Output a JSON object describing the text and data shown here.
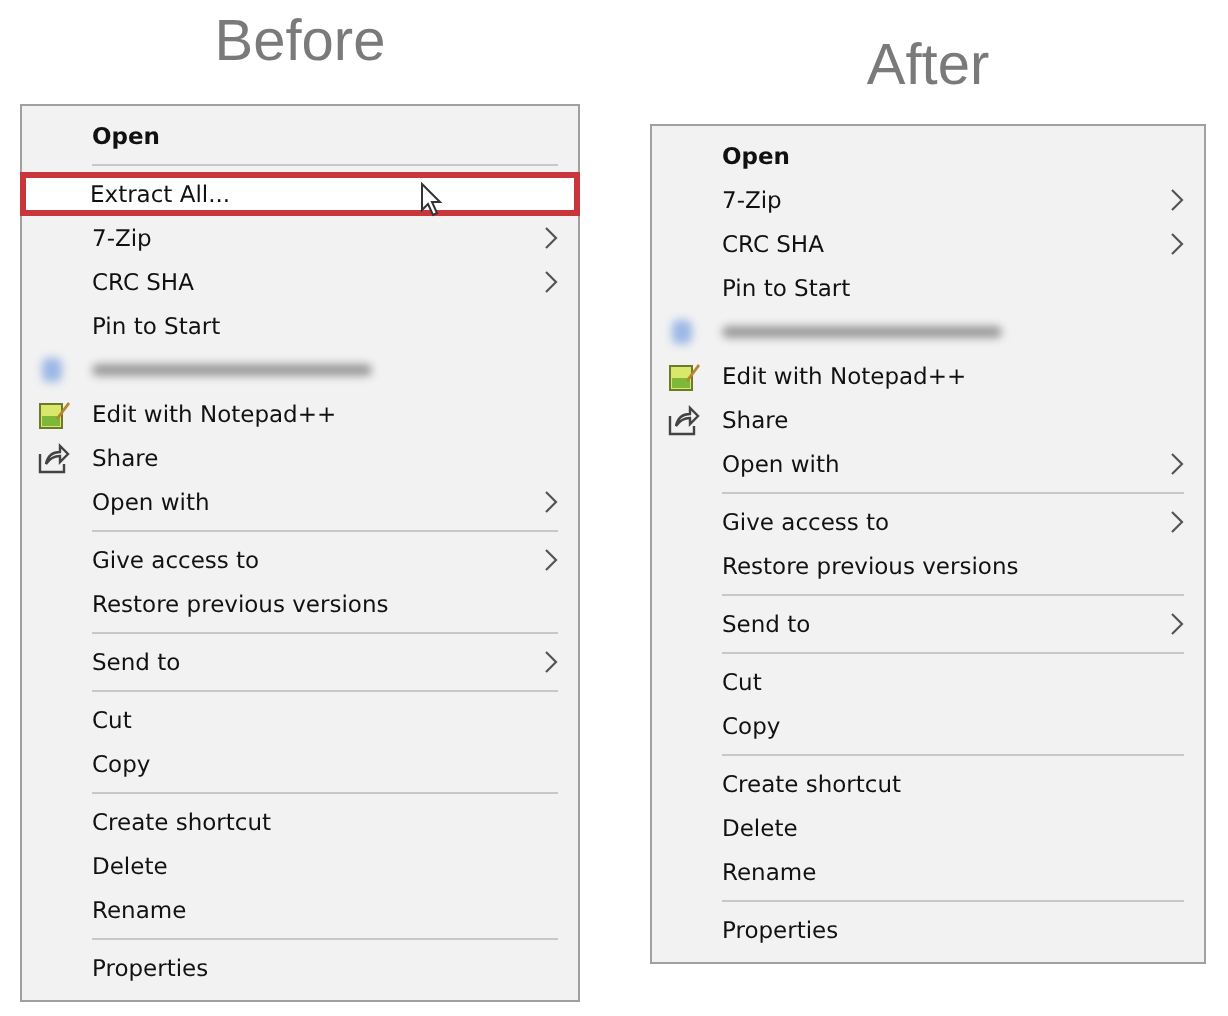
{
  "panels": [
    {
      "heading": "Before",
      "items": [
        {
          "kind": "item",
          "label": "Open",
          "bold": true,
          "submenu": false,
          "selected": false
        },
        {
          "kind": "separator"
        },
        {
          "kind": "item",
          "label": "Extract All...",
          "bold": false,
          "submenu": false,
          "selected": true
        },
        {
          "kind": "item",
          "label": "7-Zip",
          "bold": false,
          "submenu": true,
          "selected": false
        },
        {
          "kind": "item",
          "label": "CRC SHA",
          "bold": false,
          "submenu": true,
          "selected": false
        },
        {
          "kind": "item",
          "label": "Pin to Start",
          "bold": false,
          "submenu": false,
          "selected": false
        },
        {
          "kind": "blurred"
        },
        {
          "kind": "edit-item",
          "label": "Edit with Notepad++",
          "bold": false,
          "submenu": false,
          "selected": false
        },
        {
          "kind": "share-item",
          "label": "Share",
          "bold": false,
          "submenu": false,
          "selected": false
        },
        {
          "kind": "item",
          "label": "Open with",
          "bold": false,
          "submenu": true,
          "selected": false
        },
        {
          "kind": "separator"
        },
        {
          "kind": "item",
          "label": "Give access to",
          "bold": false,
          "submenu": true,
          "selected": false
        },
        {
          "kind": "item",
          "label": "Restore previous versions",
          "bold": false,
          "submenu": false,
          "selected": false
        },
        {
          "kind": "separator"
        },
        {
          "kind": "item",
          "label": "Send to",
          "bold": false,
          "submenu": true,
          "selected": false
        },
        {
          "kind": "separator"
        },
        {
          "kind": "item",
          "label": "Cut",
          "bold": false,
          "submenu": false,
          "selected": false
        },
        {
          "kind": "item",
          "label": "Copy",
          "bold": false,
          "submenu": false,
          "selected": false
        },
        {
          "kind": "separator"
        },
        {
          "kind": "item",
          "label": "Create shortcut",
          "bold": false,
          "submenu": false,
          "selected": false
        },
        {
          "kind": "item",
          "label": "Delete",
          "bold": false,
          "submenu": false,
          "selected": false
        },
        {
          "kind": "item",
          "label": "Rename",
          "bold": false,
          "submenu": false,
          "selected": false
        },
        {
          "kind": "separator"
        },
        {
          "kind": "item",
          "label": "Properties",
          "bold": false,
          "submenu": false,
          "selected": false
        }
      ]
    },
    {
      "heading": "After",
      "items": [
        {
          "kind": "item",
          "label": "Open",
          "bold": true,
          "submenu": false,
          "selected": false
        },
        {
          "kind": "item",
          "label": "7-Zip",
          "bold": false,
          "submenu": true,
          "selected": false
        },
        {
          "kind": "item",
          "label": "CRC SHA",
          "bold": false,
          "submenu": true,
          "selected": false
        },
        {
          "kind": "item",
          "label": "Pin to Start",
          "bold": false,
          "submenu": false,
          "selected": false
        },
        {
          "kind": "blurred"
        },
        {
          "kind": "edit-item",
          "label": "Edit with Notepad++",
          "bold": false,
          "submenu": false,
          "selected": false
        },
        {
          "kind": "share-item",
          "label": "Share",
          "bold": false,
          "submenu": false,
          "selected": false
        },
        {
          "kind": "item",
          "label": "Open with",
          "bold": false,
          "submenu": true,
          "selected": false
        },
        {
          "kind": "separator"
        },
        {
          "kind": "item",
          "label": "Give access to",
          "bold": false,
          "submenu": true,
          "selected": false
        },
        {
          "kind": "item",
          "label": "Restore previous versions",
          "bold": false,
          "submenu": false,
          "selected": false
        },
        {
          "kind": "separator"
        },
        {
          "kind": "item",
          "label": "Send to",
          "bold": false,
          "submenu": true,
          "selected": false
        },
        {
          "kind": "separator"
        },
        {
          "kind": "item",
          "label": "Cut",
          "bold": false,
          "submenu": false,
          "selected": false
        },
        {
          "kind": "item",
          "label": "Copy",
          "bold": false,
          "submenu": false,
          "selected": false
        },
        {
          "kind": "separator"
        },
        {
          "kind": "item",
          "label": "Create shortcut",
          "bold": false,
          "submenu": false,
          "selected": false
        },
        {
          "kind": "item",
          "label": "Delete",
          "bold": false,
          "submenu": false,
          "selected": false
        },
        {
          "kind": "item",
          "label": "Rename",
          "bold": false,
          "submenu": false,
          "selected": false
        },
        {
          "kind": "separator"
        },
        {
          "kind": "item",
          "label": "Properties",
          "bold": false,
          "submenu": false,
          "selected": false
        }
      ]
    }
  ]
}
